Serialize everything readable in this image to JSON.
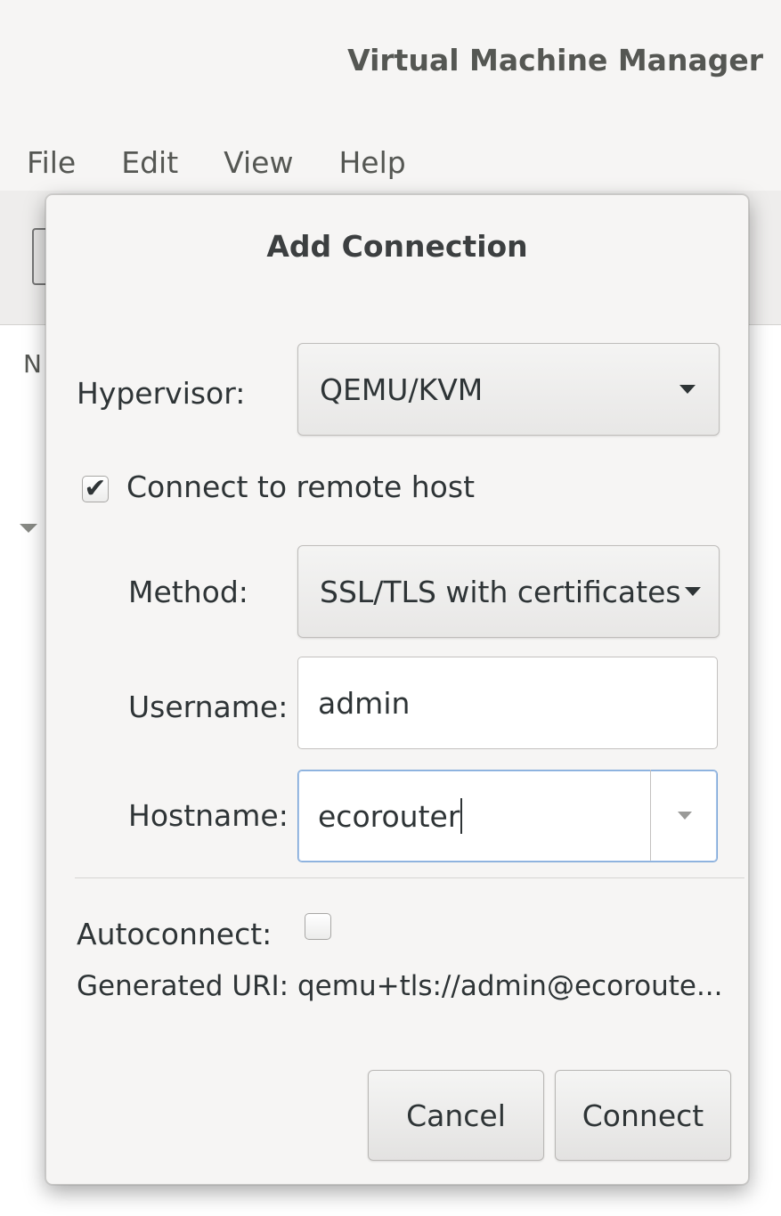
{
  "window": {
    "title": "Virtual Machine Manager"
  },
  "menubar": {
    "items": [
      "File",
      "Edit",
      "View",
      "Help"
    ]
  },
  "background_list": {
    "header_fragment": "N"
  },
  "dialog": {
    "title": "Add Connection",
    "hypervisor_label": "Hypervisor:",
    "hypervisor_value": "QEMU/KVM",
    "remote_checkbox_label": "Connect to remote host",
    "remote_checked": true,
    "method_label": "Method:",
    "method_value": "SSL/TLS with certificates",
    "username_label": "Username:",
    "username_value": "admin",
    "hostname_label": "Hostname:",
    "hostname_value": "ecorouter",
    "autoconnect_label": "Autoconnect:",
    "autoconnect_checked": false,
    "uri_label": "Generated URI:",
    "uri_value": "qemu+tls://admin@ecoroute...",
    "cancel_label": "Cancel",
    "connect_label": "Connect"
  }
}
